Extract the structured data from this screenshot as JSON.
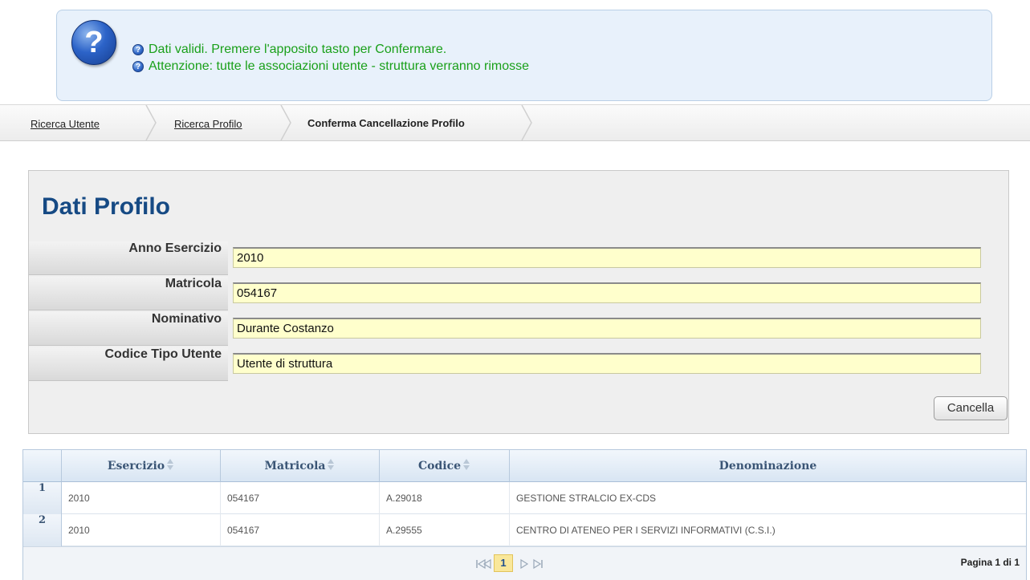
{
  "messages": {
    "line1": "Dati validi. Premere l'apposito tasto per Confermare.",
    "line2": "Attenzione: tutte le associazioni utente - struttura verranno rimosse"
  },
  "breadcrumb": {
    "items": [
      "Ricerca Utente",
      "Ricerca Profilo",
      "Conferma Cancellazione Profilo"
    ]
  },
  "profile": {
    "title": "Dati Profilo",
    "fields": [
      {
        "label": "Anno Esercizio",
        "value": "2010"
      },
      {
        "label": "Matricola",
        "value": "054167"
      },
      {
        "label": "Nominativo",
        "value": "Durante Costanzo"
      },
      {
        "label": "Codice Tipo Utente",
        "value": "Utente di struttura"
      }
    ],
    "cancel_label": "Cancella"
  },
  "grid": {
    "headers": [
      "Esercizio",
      "Matricola",
      "Codice",
      "Denominazione"
    ],
    "rows": [
      {
        "num": "1",
        "esercizio": "2010",
        "matricola": "054167",
        "codice": "A.29018",
        "denominazione": "GESTIONE STRALCIO EX-CDS"
      },
      {
        "num": "2",
        "esercizio": "2010",
        "matricola": "054167",
        "codice": "A.29555",
        "denominazione": "CENTRO DI ATENEO PER I SERVIZI INFORMATIVI (C.S.I.)"
      }
    ],
    "pager": {
      "current": "1",
      "info": "Pagina 1 di 1"
    }
  },
  "colors": {
    "success_text": "#1aa01a",
    "title": "#164a84",
    "field_bg": "#ffffcc"
  }
}
